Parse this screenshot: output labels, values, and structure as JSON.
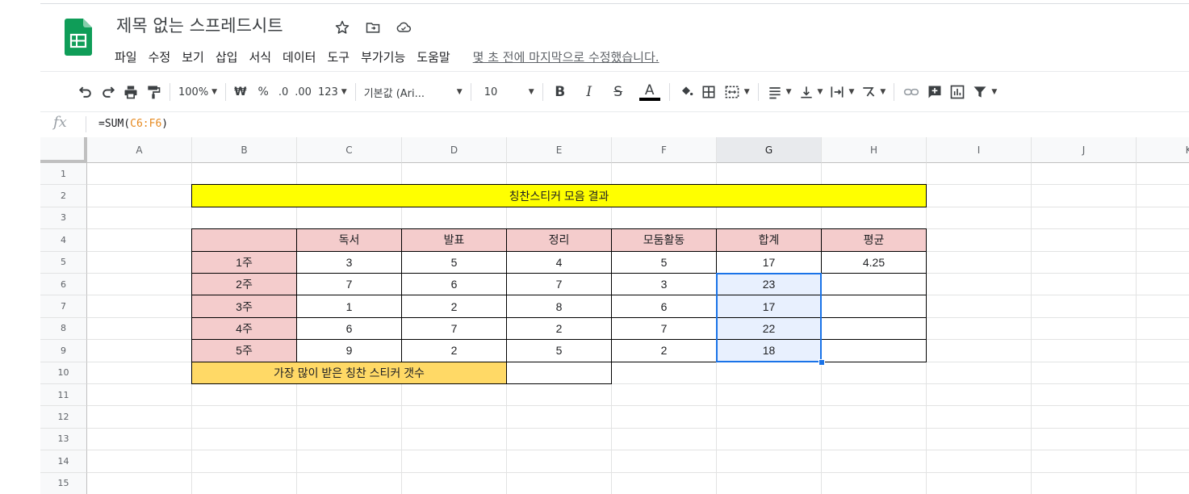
{
  "app": {
    "title": "제목 없는 스프레드시트",
    "menus": [
      "파일",
      "수정",
      "보기",
      "삽입",
      "서식",
      "데이터",
      "도구",
      "부가기능",
      "도움말"
    ],
    "last_edit": "몇 초 전에 마지막으로 수정했습니다."
  },
  "toolbar": {
    "zoom": "100%",
    "currency": "₩",
    "percent": "%",
    "dec_decrease": ".0",
    "dec_increase": ".00",
    "more_formats": "123",
    "font": "기본값 (Ari...",
    "font_size": "10",
    "bold": "B",
    "italic": "I",
    "strike": "S",
    "text_color": "A"
  },
  "formula_bar": {
    "fx": "fx",
    "prefix": "=SUM(",
    "ref": "C6:F6",
    "suffix": ")"
  },
  "sheet": {
    "columns": [
      "A",
      "B",
      "C",
      "D",
      "E",
      "F",
      "G",
      "H",
      "I",
      "J",
      "K"
    ],
    "selected_column": "G",
    "rows": [
      "1",
      "2",
      "3",
      "4",
      "5",
      "6",
      "7",
      "8",
      "9",
      "10",
      "11",
      "12",
      "13",
      "14",
      "15"
    ],
    "banner": "칭찬스티커 모음 결과",
    "headers": [
      "독서",
      "발표",
      "정리",
      "모둠활동",
      "합계",
      "평균"
    ],
    "data": [
      {
        "week": "1주",
        "values": [
          "3",
          "5",
          "4",
          "5",
          "17",
          "4.25"
        ]
      },
      {
        "week": "2주",
        "values": [
          "7",
          "6",
          "7",
          "3",
          "23",
          ""
        ]
      },
      {
        "week": "3주",
        "values": [
          "1",
          "2",
          "8",
          "6",
          "17",
          ""
        ]
      },
      {
        "week": "4주",
        "values": [
          "6",
          "7",
          "2",
          "7",
          "22",
          ""
        ]
      },
      {
        "week": "5주",
        "values": [
          "9",
          "2",
          "5",
          "2",
          "18",
          ""
        ]
      }
    ],
    "most_label": "가장 많이 받은 칭찬 스티커 갯수",
    "most_value": ""
  },
  "colors": {
    "banner": "#ffff00",
    "header_fill": "#f4cccc",
    "most_fill": "#ffd966",
    "selection": "#1a73e8",
    "selection_fill": "#e8f0fe",
    "logo_green": "#0f9d58"
  }
}
